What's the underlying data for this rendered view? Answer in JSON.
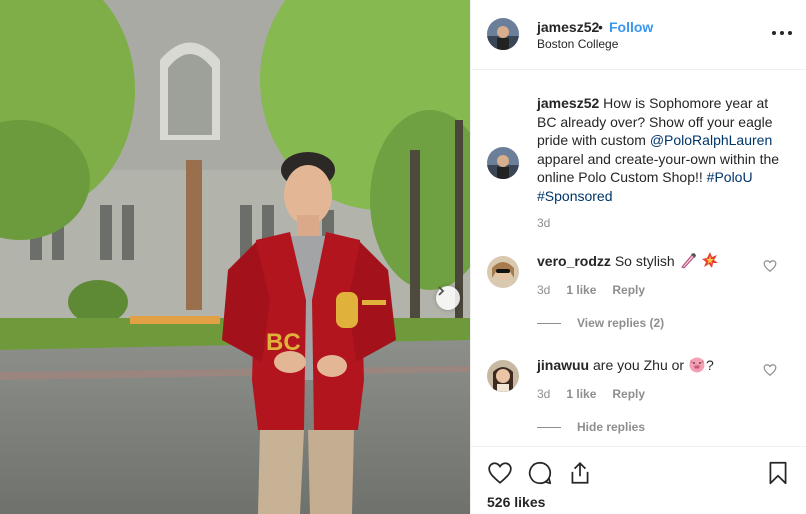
{
  "post": {
    "author": "jamesz52",
    "follow_label": "Follow",
    "dot": "•",
    "location": "Boston College",
    "caption": {
      "author": "jamesz52",
      "text_1": " How is Sophomore year at BC already over? Show off your eagle pride with custom ",
      "mention": "@PoloRalphLauren",
      "text_2": " apparel and create-your-own within the online Polo Custom Shop!! ",
      "hashtag_1": "#PoloU",
      "hashtag_2": "#Sponsored",
      "time": "3d"
    },
    "comments": [
      {
        "author": "vero_rodzz",
        "text": "So stylish",
        "emojis": [
          "paint-brush-emoji",
          "collision-emoji"
        ],
        "time": "3d",
        "likes": "1 like",
        "reply": "Reply",
        "replies_toggle": "View replies (2)"
      },
      {
        "author": "jinawuu",
        "text": "are you Zhu or",
        "emoji_after": "pig-face-emoji",
        "suffix": "?",
        "time": "3d",
        "likes": "1 like",
        "reply": "Reply",
        "replies_toggle": "Hide replies"
      }
    ],
    "likes_count": "526 likes",
    "icons": [
      "heart-icon",
      "comment-icon",
      "share-icon",
      "bookmark-icon",
      "more-icon",
      "next-arrow-icon"
    ]
  },
  "colors": {
    "link": "#003569",
    "follow": "#3897f0",
    "muted": "#8e8e8e",
    "text": "#262626",
    "cardigan": "#b3151f"
  }
}
